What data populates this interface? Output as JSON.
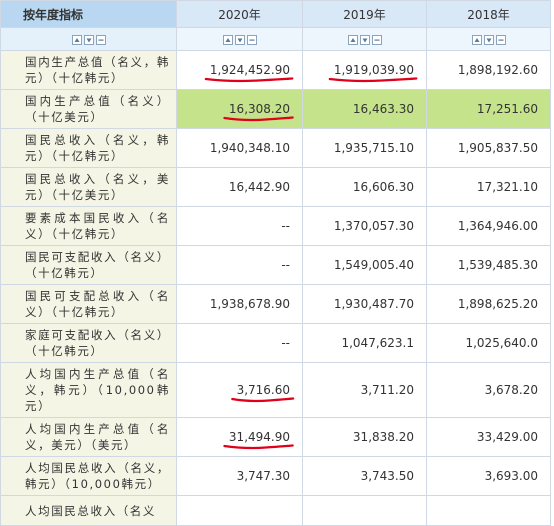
{
  "header": {
    "indicator_col": "按年度指标",
    "years": [
      "2020年",
      "2019年",
      "2018年"
    ]
  },
  "controls": {
    "icons": [
      "up-triangle-icon",
      "down-triangle-icon",
      "minus-icon"
    ],
    "color": "#8aa4bf"
  },
  "annotation_color": "#e0001b",
  "highlight_color": "#c4e38b",
  "rows": [
    {
      "label": "国内生产总值（名义，韩元）（十亿韩元）",
      "values": [
        "1,924,452.90",
        "1,919,039.90",
        "1,898,192.60"
      ]
    },
    {
      "label": "国内生产总值（名义）（十亿美元）",
      "values": [
        "16,308.20",
        "16,463.30",
        "17,251.60"
      ]
    },
    {
      "label": "国民总收入（名义，韩元）（十亿韩元）",
      "values": [
        "1,940,348.10",
        "1,935,715.10",
        "1,905,837.50"
      ]
    },
    {
      "label": "国民总收入（名义，美元）（十亿美元）",
      "values": [
        "16,442.90",
        "16,606.30",
        "17,321.10"
      ]
    },
    {
      "label": "要素成本国民收入（名义）（十亿韩元）",
      "values": [
        "--",
        "1,370,057.30",
        "1,364,946.00"
      ]
    },
    {
      "label": "国民可支配收入（名义）（十亿韩元）",
      "values": [
        "--",
        "1,549,005.40",
        "1,539,485.30"
      ]
    },
    {
      "label": "国民可支配总收入（名义）（十亿韩元）",
      "values": [
        "1,938,678.90",
        "1,930,487.70",
        "1,898,625.20"
      ]
    },
    {
      "label": "家庭可支配收入（名义）（十亿韩元）",
      "values": [
        "--",
        "1,047,623.1",
        "1,025,640.0"
      ]
    },
    {
      "label": "人均国内生产总值（名义，韩元）（10,000韩元）",
      "values": [
        "3,716.60",
        "3,711.20",
        "3,678.20"
      ]
    },
    {
      "label": "人均国内生产总值（名义，美元）（美元）",
      "values": [
        "31,494.90",
        "31,838.20",
        "33,429.00"
      ]
    },
    {
      "label": "人均国民总收入（名义，韩元）（10,000韩元）",
      "values": [
        "3,747.30",
        "3,743.50",
        "3,693.00"
      ]
    },
    {
      "label": "人均国民总收入（名义",
      "values": [
        "",
        "",
        ""
      ]
    }
  ]
}
